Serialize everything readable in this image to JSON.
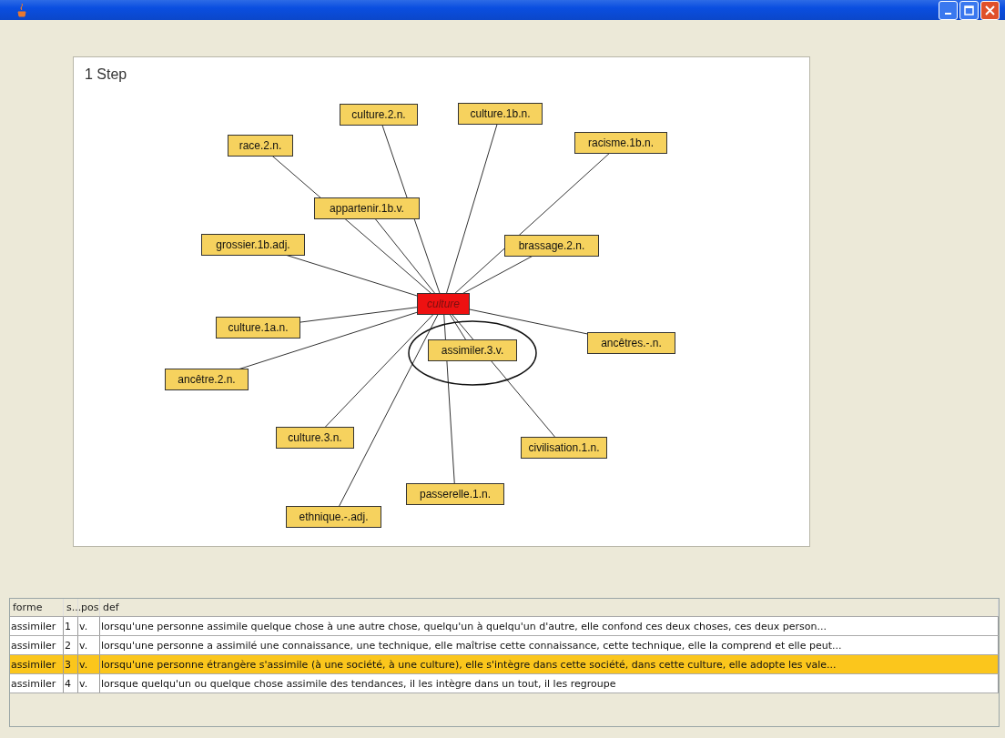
{
  "graph": {
    "title": "1 Step",
    "root": {
      "label": "culture"
    },
    "nodes": [
      {
        "label": "culture.2.n."
      },
      {
        "label": "culture.1b.n."
      },
      {
        "label": "race.2.n."
      },
      {
        "label": "racisme.1b.n."
      },
      {
        "label": "appartenir.1b.v."
      },
      {
        "label": "grossier.1b.adj."
      },
      {
        "label": "brassage.2.n."
      },
      {
        "label": "culture.1a.n."
      },
      {
        "label": "ancêtres.-.n."
      },
      {
        "label": "assimiler.3.v.",
        "circled": true
      },
      {
        "label": "ancêtre.2.n."
      },
      {
        "label": "culture.3.n."
      },
      {
        "label": "civilisation.1.n."
      },
      {
        "label": "passerelle.1.n."
      },
      {
        "label": "ethnique.-.adj."
      }
    ]
  },
  "table": {
    "columns": [
      "forme",
      "s...",
      "pos",
      "def"
    ],
    "rows": [
      {
        "cells": [
          "assimiler",
          "1",
          "v.",
          "lorsqu'une personne assimile quelque chose à une autre chose, quelqu'un à quelqu'un d'autre, elle confond ces deux choses, ces deux person..."
        ],
        "selected": false
      },
      {
        "cells": [
          "assimiler",
          "2",
          "v.",
          "lorsqu'une personne a assimilé une connaissance, une technique, elle maîtrise cette connaissance, cette technique, elle la comprend et elle peut..."
        ],
        "selected": false
      },
      {
        "cells": [
          "assimiler",
          "3",
          "v.",
          "lorsqu'une personne étrangère s'assimile (à une société, à une culture), elle s'intègre dans cette société, dans cette culture, elle adopte les vale..."
        ],
        "selected": true
      },
      {
        "cells": [
          "assimiler",
          "4",
          "v.",
          "lorsque quelqu'un ou quelque chose assimile des tendances, il les intègre dans un tout, il les regroupe"
        ],
        "selected": false
      }
    ]
  }
}
